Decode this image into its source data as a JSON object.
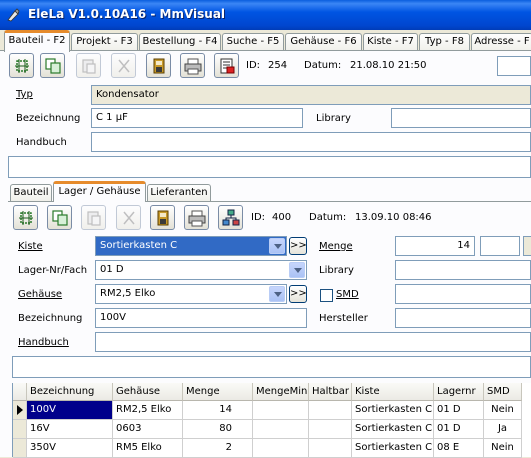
{
  "window": {
    "title": "EleLa V1.0.10A16  -  MmVisual"
  },
  "tabs": [
    {
      "label": "Bauteil - F2",
      "active": true
    },
    {
      "label": "Projekt - F3"
    },
    {
      "label": "Bestellung - F4"
    },
    {
      "label": "Suche - F5"
    },
    {
      "label": "Gehäuse - F6"
    },
    {
      "label": "Kiste - F7"
    },
    {
      "label": "Typ - F8"
    },
    {
      "label": "Adresse - F"
    }
  ],
  "part": {
    "id_label": "ID:",
    "id_value": "254",
    "date_label": "Datum:",
    "date_value": "21.08.10 21:50",
    "typ_label": "Typ",
    "typ_value": "Kondensator",
    "bezeichnung_label": "Bezeichnung",
    "bezeichnung_value": "C 1 µF",
    "library_label": "Library",
    "library_value": "",
    "handbuch_label": "Handbuch",
    "handbuch_value": ""
  },
  "subtabs": [
    {
      "label": "Bauteil"
    },
    {
      "label": "Lager / Gehäuse",
      "active": true
    },
    {
      "label": "Lieferanten"
    }
  ],
  "storage": {
    "id_label": "ID:",
    "id_value": "400",
    "date_label": "Datum:",
    "date_value": "13.09.10 08:46",
    "kiste_label": "Kiste",
    "kiste_value": "Sortierkasten C",
    "lagernr_label": "Lager-Nr/Fach",
    "lagernr_value": "01 D",
    "gehaeuse_label": "Gehäuse",
    "gehaeuse_value": "RM2,5 Elko",
    "bezeichnung_label": "Bezeichnung",
    "bezeichnung_value": "100V",
    "handbuch_label": "Handbuch",
    "handbuch_value": "",
    "menge_label": "Menge",
    "menge_value": "14",
    "library_label": "Library",
    "library_value": "",
    "smd_label": "SMD",
    "smd_checked": false,
    "hersteller_label": "Hersteller",
    "hersteller_value": "",
    "dots_label": ">>"
  },
  "table": {
    "columns": [
      "Bezeichnung",
      "Gehäuse",
      "Menge",
      "MengeMin",
      "Haltbar",
      "Kiste",
      "Lagernr",
      "SMD"
    ],
    "rows": [
      [
        "100V",
        "RM2,5 Elko",
        "14",
        "",
        "",
        "Sortierkasten C",
        "01 D",
        "Nein"
      ],
      [
        "16V",
        "0603",
        "80",
        "",
        "",
        "Sortierkasten C",
        "01 D",
        "Ja"
      ],
      [
        "350V",
        "RM5 Elko",
        "2",
        "",
        "",
        "Sortierkasten C",
        "08 E",
        "Nein"
      ]
    ]
  },
  "colors": {
    "titlebar": "#0055e3",
    "selection": "#00008b",
    "tab_accent": "#e68b2c"
  }
}
